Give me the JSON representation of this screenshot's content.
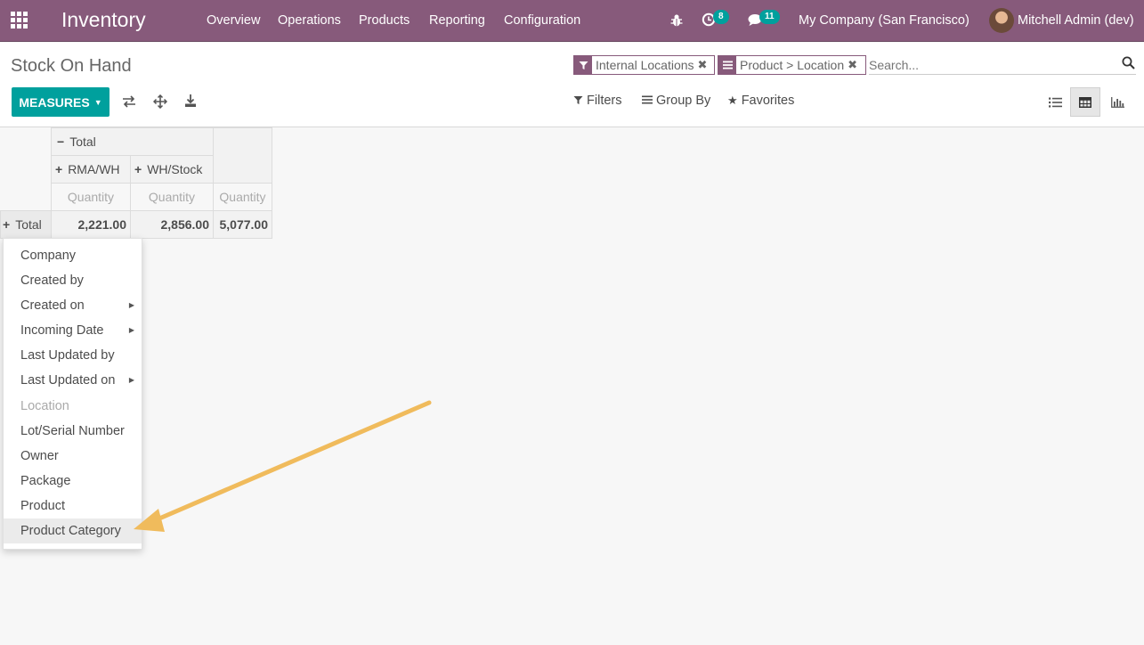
{
  "navbar": {
    "brand": "Inventory",
    "menu": [
      "Overview",
      "Operations",
      "Products",
      "Reporting",
      "Configuration"
    ],
    "activity_count": "8",
    "message_count": "11",
    "company": "My Company (San Francisco)",
    "user": "Mitchell Admin (dev)",
    "color": "#875a7b"
  },
  "control_panel": {
    "title": "Stock On Hand",
    "measures_label": "MEASURES",
    "facets": [
      "Internal Locations",
      "Product > Location"
    ],
    "search_placeholder": "Search...",
    "filters_label": "Filters",
    "groupby_label": "Group By",
    "favorites_label": "Favorites",
    "accent": "#00a09d"
  },
  "pivot": {
    "col_total_label": "Total",
    "col_groups": [
      "RMA/WH",
      "WH/Stock"
    ],
    "measure_label": "Quantity",
    "row_total_label": "Total",
    "values": [
      "2,221.00",
      "2,856.00",
      "5,077.00"
    ]
  },
  "groupby_dropdown": {
    "items": [
      "Company",
      "Created by",
      "Created on",
      "Incoming Date",
      "Last Updated by",
      "Last Updated on",
      "Location",
      "Lot/Serial Number",
      "Owner",
      "Package",
      "Product",
      "Product Category"
    ]
  }
}
